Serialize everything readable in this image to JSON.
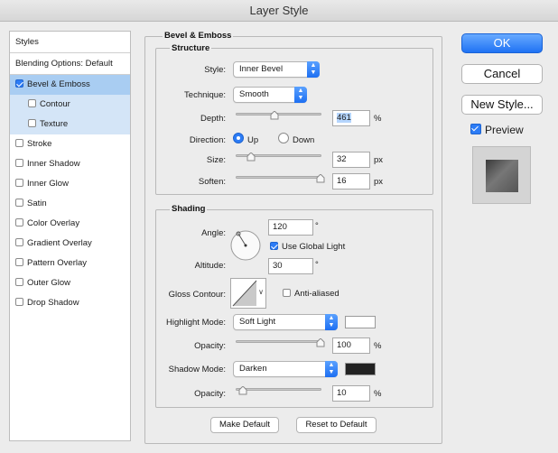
{
  "window": {
    "title": "Layer Style"
  },
  "style_list": {
    "header": "Styles",
    "blending_options": "Blending Options: Default",
    "items": [
      {
        "label": "Bevel & Emboss",
        "checked": true,
        "selected": true
      },
      {
        "label": "Contour",
        "checked": false,
        "sub": true
      },
      {
        "label": "Texture",
        "checked": false,
        "sub": true
      },
      {
        "label": "Stroke",
        "checked": false
      },
      {
        "label": "Inner Shadow",
        "checked": false
      },
      {
        "label": "Inner Glow",
        "checked": false
      },
      {
        "label": "Satin",
        "checked": false
      },
      {
        "label": "Color Overlay",
        "checked": false
      },
      {
        "label": "Gradient Overlay",
        "checked": false
      },
      {
        "label": "Pattern Overlay",
        "checked": false
      },
      {
        "label": "Outer Glow",
        "checked": false
      },
      {
        "label": "Drop Shadow",
        "checked": false
      }
    ]
  },
  "bevel": {
    "title": "Bevel & Emboss",
    "structure": {
      "title": "Structure",
      "style_label": "Style:",
      "style_value": "Inner Bevel",
      "technique_label": "Technique:",
      "technique_value": "Smooth",
      "depth_label": "Depth:",
      "depth_value": "461",
      "depth_unit": "%",
      "depth_slider": 0.46,
      "direction_label": "Direction:",
      "direction_up": "Up",
      "direction_down": "Down",
      "direction_selected": "Up",
      "size_label": "Size:",
      "size_value": "32",
      "size_unit": "px",
      "size_slider": 0.18,
      "soften_label": "Soften:",
      "soften_value": "16",
      "soften_unit": "px",
      "soften_slider": 1.0
    },
    "shading": {
      "title": "Shading",
      "angle_label": "Angle:",
      "angle_value": "120",
      "angle_unit": "°",
      "global_light_label": "Use Global Light",
      "global_light_checked": true,
      "altitude_label": "Altitude:",
      "altitude_value": "30",
      "altitude_unit": "°",
      "gloss_contour_label": "Gloss Contour:",
      "anti_aliased_label": "Anti-aliased",
      "anti_aliased_checked": false,
      "highlight_mode_label": "Highlight Mode:",
      "highlight_mode_value": "Soft Light",
      "highlight_color": "#ffffff",
      "highlight_opacity_label": "Opacity:",
      "highlight_opacity_value": "100",
      "highlight_opacity_unit": "%",
      "highlight_opacity_slider": 1.0,
      "shadow_mode_label": "Shadow Mode:",
      "shadow_mode_value": "Darken",
      "shadow_color": "#222222",
      "shadow_opacity_label": "Opacity:",
      "shadow_opacity_value": "10",
      "shadow_opacity_unit": "%",
      "shadow_opacity_slider": 0.1
    },
    "make_default": "Make Default",
    "reset_default": "Reset to Default"
  },
  "buttons": {
    "ok": "OK",
    "cancel": "Cancel",
    "new_style": "New Style...",
    "preview_label": "Preview",
    "preview_checked": true
  },
  "colors": {
    "accent": "#2c7cf6",
    "selection": "#a9cdf2"
  }
}
